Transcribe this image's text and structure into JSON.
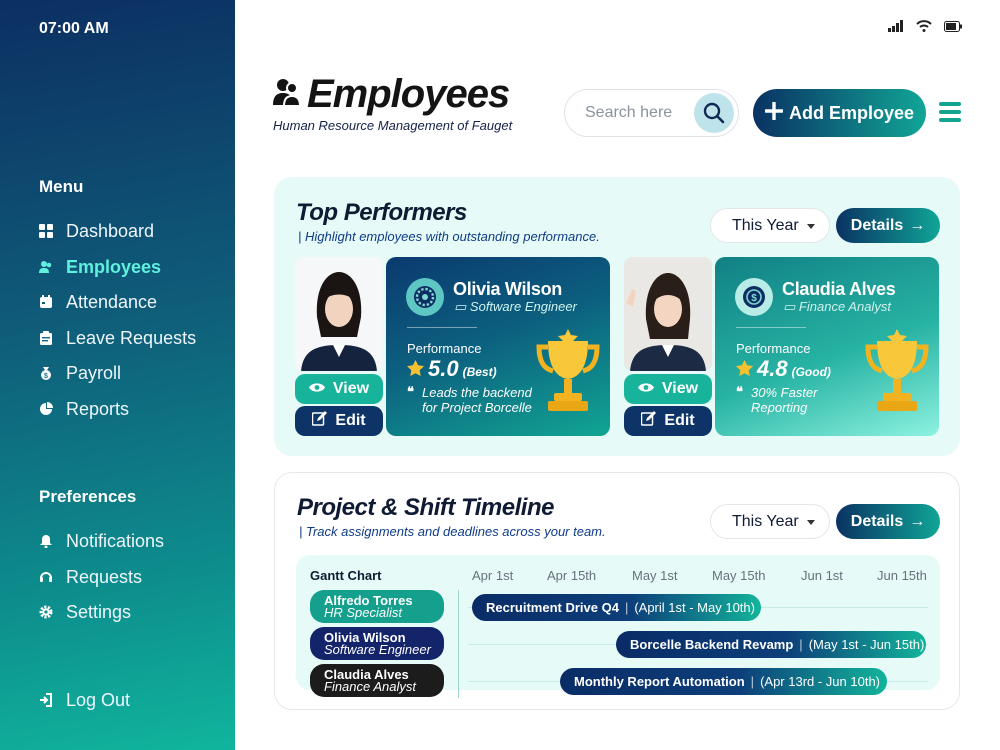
{
  "status": {
    "time": "07:00 AM"
  },
  "sidebar": {
    "menu_title": "Menu",
    "menu": [
      {
        "label": "Dashboard",
        "icon": "grid-icon"
      },
      {
        "label": "Employees",
        "icon": "users-icon",
        "active": true
      },
      {
        "label": "Attendance",
        "icon": "calendar-icon"
      },
      {
        "label": "Leave Requests",
        "icon": "clipboard-icon"
      },
      {
        "label": "Payroll",
        "icon": "money-bag-icon"
      },
      {
        "label": "Reports",
        "icon": "pie-chart-icon"
      }
    ],
    "pref_title": "Preferences",
    "preferences": [
      {
        "label": "Notifications",
        "icon": "bell-icon"
      },
      {
        "label": "Requests",
        "icon": "headset-icon"
      },
      {
        "label": "Settings",
        "icon": "gear-icon"
      }
    ],
    "logout": "Log Out"
  },
  "header": {
    "title": "Employees",
    "subtitle": "Human Resource Management of Fauget",
    "search_placeholder": "Search here",
    "add_label": "Add Employee"
  },
  "top_performers": {
    "title": "Top Performers",
    "subtitle": "Highlight employees with outstanding performance.",
    "period": "This Year",
    "details": "Details",
    "view_label": "View",
    "edit_label": "Edit",
    "performance_label": "Performance",
    "people": [
      {
        "name": "Olivia Wilson",
        "role": "Software Engineer",
        "rating": "5.0",
        "rating_tag": "(Best)",
        "note": "Leads the backend for Project Borcelle"
      },
      {
        "name": "Claudia Alves",
        "role": "Finance Analyst",
        "rating": "4.8",
        "rating_tag": "(Good)",
        "note": "30% Faster Reporting"
      }
    ]
  },
  "timeline": {
    "title": "Project & Shift Timeline",
    "subtitle": "Track assignments and deadlines across your team.",
    "period": "This Year",
    "details": "Details",
    "gantt_title": "Gantt Chart",
    "dates": [
      "Apr 1st",
      "Apr 15th",
      "May 1st",
      "May 15th",
      "Jun 1st",
      "Jun 15th"
    ],
    "people": [
      {
        "name": "Alfredo Torres",
        "role": "HR Specialist",
        "color": "#14a08c"
      },
      {
        "name": "Olivia Wilson",
        "role": "Software Engineer",
        "color": "#14246b"
      },
      {
        "name": "Claudia Alves",
        "role": "Finance Analyst",
        "color": "#1c1c1c"
      }
    ],
    "tasks": [
      {
        "name": "Recruitment Drive Q4",
        "range": "(April 1st - May 10th)"
      },
      {
        "name": "Borcelle Backend Revamp",
        "range": "(May 1st - Jun 15th)"
      },
      {
        "name": "Monthly Report Automation",
        "range": "(Apr 13rd - Jun 10th)"
      }
    ]
  }
}
